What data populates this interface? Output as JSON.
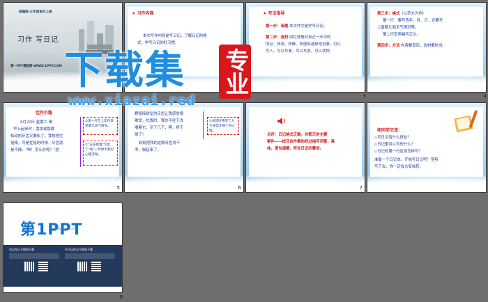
{
  "slide1": {
    "series": "部编版·三年级语文上册",
    "title": "习作  写日记",
    "site": "第一PPT模板网-WWW.1PPT.COM",
    "number": ""
  },
  "slide2": {
    "header": "习作内容",
    "lines": [
      "本次写作内容是写日记，了解日记的格",
      "式，学写日记的好习惯。"
    ],
    "number": ""
  },
  "slide3": {
    "header": "写法指导",
    "step1_label": "第一步：审题",
    "step1_text": "本次作文是学写日记。",
    "step2_label": "第二步：选材",
    "step2_text": "回忆就是对自己一天中的",
    "step2_lines": [
      "所见、所闻、所做、所感有选择地记录。可以",
      "写人，可以写事，可以写景，可以状物。"
    ],
    "number": "3"
  },
  "slide4": {
    "step3_label": "第三步：格式",
    "step3_note": "（以范文为例）",
    "lines": [
      "第一行：要写清年、月、日，还要写",
      "上星期几和天气情况等。",
      "第二行空两格写正文。"
    ],
    "step4_label": "第四步：方法",
    "step4_text": "内容要真实，选材要恰当。",
    "number": "4"
  },
  "slide5": {
    "header": "佳作引路",
    "date_line": "8月20日  星期二  晴",
    "lines": [
      "早上起来时，我发现那颗",
      "松动的牙齿又要松了。我想把它",
      "摇掉，可是在摇的时候，牙齿就",
      "是不掉。\"唉！怎么办呢？\"这"
    ],
    "note1": "①第一行写上年月日星期几天气情况。",
    "note2": "②\"正在摇着\"写出了\"唉\"一时想不到的心理活动。",
    "number": "5"
  },
  "slide6": {
    "lines": [
      "颗摇摇欲坠的牙齿让我感觉很",
      "难受，吃饭时，我总不往下去",
      "嚼着它，见了几下，啊，终于",
      "掉了！",
      "妈妈把我的这颗牙齿洗干",
      "净，收起来了。"
    ],
    "note": "③想吃时用尽了力气牙齿才掉了的心理。",
    "number": "6"
  },
  "slide7": {
    "label": "点评：",
    "lines": [
      "日记格式正确，对那天的主要",
      "事件——掉牙这件事的经过描写完整，具",
      "体，语句通顺，符合日记的要求。"
    ],
    "number": "7"
  },
  "slide8": {
    "header": "和同学交流：",
    "items": [
      "◇写日记有什么好处？",
      "◇日记里可以写些什么？",
      "◇日记的第一行应该怎样写？"
    ],
    "closing": [
      "准备一个日记本，开始写日记吧！坚持",
      "写下去，你一定会大有收获。"
    ],
    "number": ""
  },
  "slide9": {
    "logo_text": "第1PPT",
    "logo_sub": "www.1ppt.com",
    "col1_title": "可以在以下网站下载",
    "col2_title": "不可以在以下网站下载",
    "number": "9"
  },
  "watermark": {
    "text": "下载集",
    "badge": "专业",
    "url": "www.xiazai.red"
  },
  "colors": {
    "text_blue": "#1e3a9a",
    "red": "#d21d1d",
    "badge_red": "#d8161c",
    "bg_gray": "#6e6e6e",
    "brand_blue": "#1f8ee0"
  }
}
